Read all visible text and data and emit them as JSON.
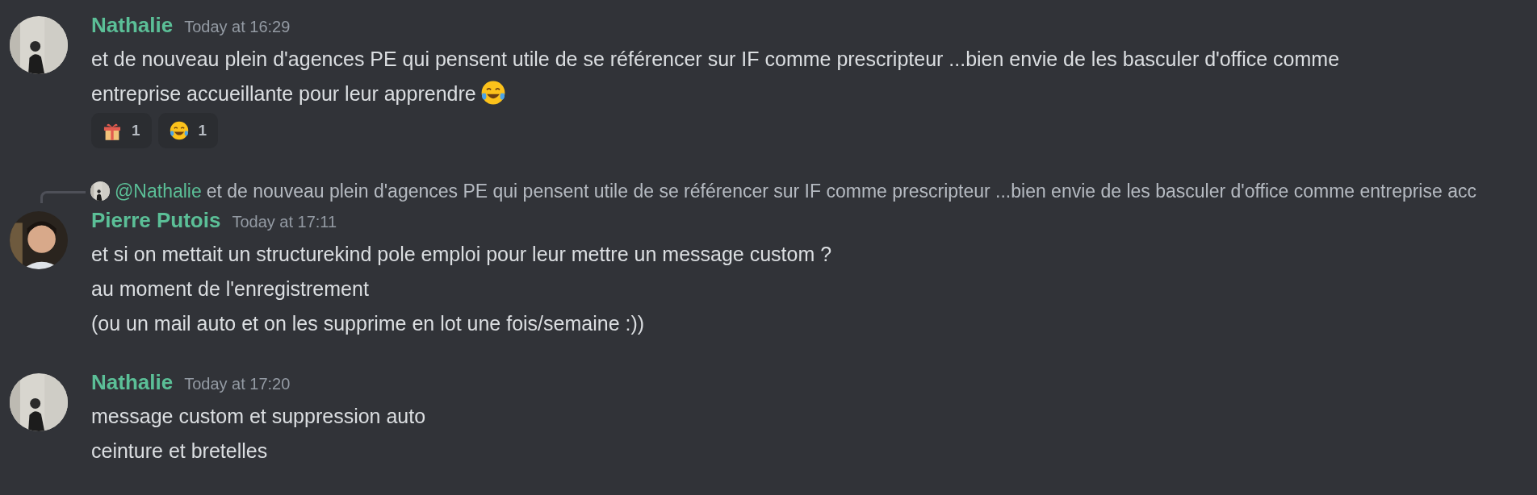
{
  "messages": [
    {
      "author": "Nathalie",
      "timestamp": "Today at 16:29",
      "paragraphs": [
        "et de nouveau plein d'agences PE qui pensent utile de se référencer sur IF comme prescripteur ...bien envie de les basculer d'office comme entreprise accueillante pour leur apprendre"
      ],
      "trailing_emoji": {
        "kind": "tears-of-joy"
      },
      "reactions": [
        {
          "kind": "gift",
          "count": "1"
        },
        {
          "kind": "tears-of-joy",
          "count": "1"
        }
      ]
    },
    {
      "author": "Pierre Putois",
      "timestamp": "Today at 17:11",
      "reply": {
        "mention": "@Nathalie",
        "text": "et de nouveau plein d'agences PE qui pensent utile de se référencer sur IF comme prescripteur ...bien envie de les basculer d'office comme entreprise acc"
      },
      "paragraphs": [
        "et si on mettait un structurekind pole emploi pour leur mettre un message custom ?",
        "au moment de l'enregistrement",
        "(ou un mail auto et on les supprime en lot une fois/semaine :))"
      ]
    },
    {
      "author": "Nathalie",
      "timestamp": "Today at 17:20",
      "paragraphs": [
        "message custom et suppression auto",
        "ceinture et bretelles"
      ]
    }
  ]
}
